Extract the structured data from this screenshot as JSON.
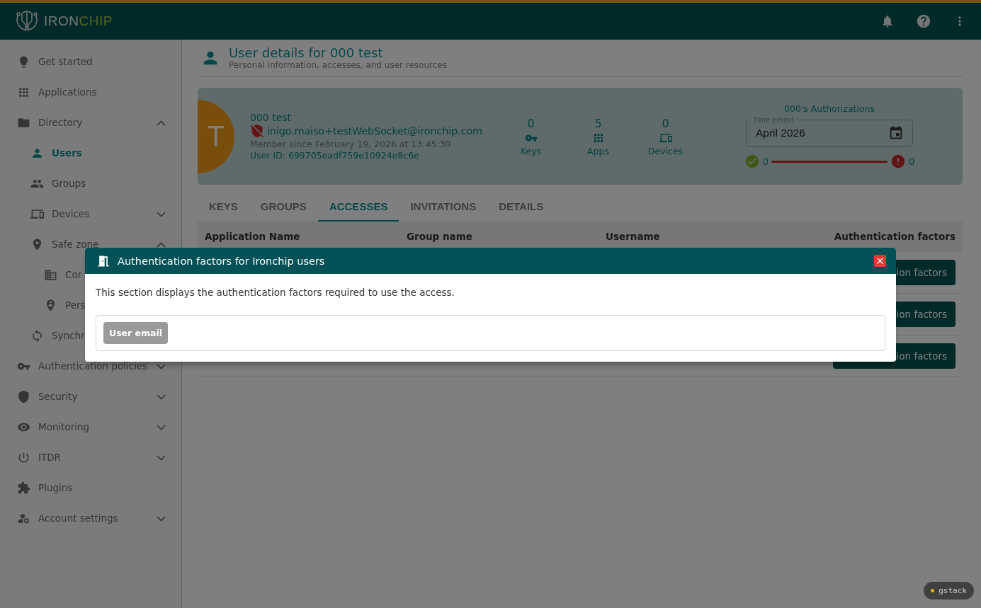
{
  "topbar": {
    "logo": {
      "brand_first": "IRON",
      "brand_second": "CHIP"
    }
  },
  "sidebar": {
    "items": [
      {
        "label": "Get started",
        "kind": "link",
        "selected": false
      },
      {
        "label": "Applications",
        "kind": "link",
        "selected": false
      },
      {
        "label": "Directory",
        "kind": "group",
        "expanded": true,
        "selected": false,
        "children": [
          {
            "label": "Users",
            "kind": "link",
            "selected": true
          },
          {
            "label": "Groups",
            "kind": "link",
            "selected": false
          },
          {
            "label": "Devices",
            "kind": "group",
            "expanded": false,
            "selected": false
          },
          {
            "label": "Safe zone",
            "kind": "group",
            "expanded": true,
            "selected": false,
            "children": [
              {
                "label": "Cor",
                "kind": "link",
                "selected": false
              },
              {
                "label": "Pers",
                "kind": "link",
                "selected": false
              }
            ]
          },
          {
            "label": "Synchr",
            "kind": "link",
            "selected": false
          }
        ]
      },
      {
        "label": "Authentication policies",
        "kind": "group",
        "expanded": false,
        "selected": false
      },
      {
        "label": "Security",
        "kind": "group",
        "expanded": false,
        "selected": false
      },
      {
        "label": "Monitoring",
        "kind": "group",
        "expanded": false,
        "selected": false
      },
      {
        "label": "ITDR",
        "kind": "group",
        "expanded": false,
        "selected": false
      },
      {
        "label": "Plugins",
        "kind": "link",
        "selected": false
      },
      {
        "label": "Account settings",
        "kind": "group",
        "expanded": false,
        "selected": false
      }
    ]
  },
  "header": {
    "title": "User details for 000 test",
    "subtitle": "Personal information, accesses, and user resources"
  },
  "user_card": {
    "avatar_initials": "T",
    "name": "000 test",
    "email": "inigo.maiso+testWebSocket@ironchip.com",
    "member_since": "Member since February 19, 2026 at 13:45:30",
    "user_id": "User ID: 699705eadf759e10924e8c6e",
    "stats": [
      {
        "kind": "keys",
        "value": "0",
        "label": "Keys"
      },
      {
        "kind": "apps",
        "value": "5",
        "label": "Apps"
      },
      {
        "kind": "devices",
        "value": "0",
        "label": "Devices"
      }
    ],
    "authorizations": {
      "title": "000's Authorizations",
      "time_period": {
        "label": "Time period",
        "value": "April 2026"
      },
      "success_count": "0",
      "failure_count": "0"
    }
  },
  "tabs": [
    {
      "label": "KEYS",
      "selected": false
    },
    {
      "label": "GROUPS",
      "selected": false
    },
    {
      "label": "ACCESSES",
      "selected": true
    },
    {
      "label": "INVITATIONS",
      "selected": false
    },
    {
      "label": "DETAILS",
      "selected": false
    }
  ],
  "table": {
    "columns": [
      "Application Name",
      "Group name",
      "Username",
      "Authentication factors"
    ],
    "rows": [
      {
        "action": "ion factors"
      },
      {
        "action": "ion factors"
      },
      {
        "action": "ion factors"
      }
    ]
  },
  "modal": {
    "title": "Authentication factors for Ironchip users",
    "description": "This section displays the authentication factors required to use the access.",
    "factors": [
      "User email"
    ]
  },
  "dev_badge": {
    "label": "gstack"
  }
}
